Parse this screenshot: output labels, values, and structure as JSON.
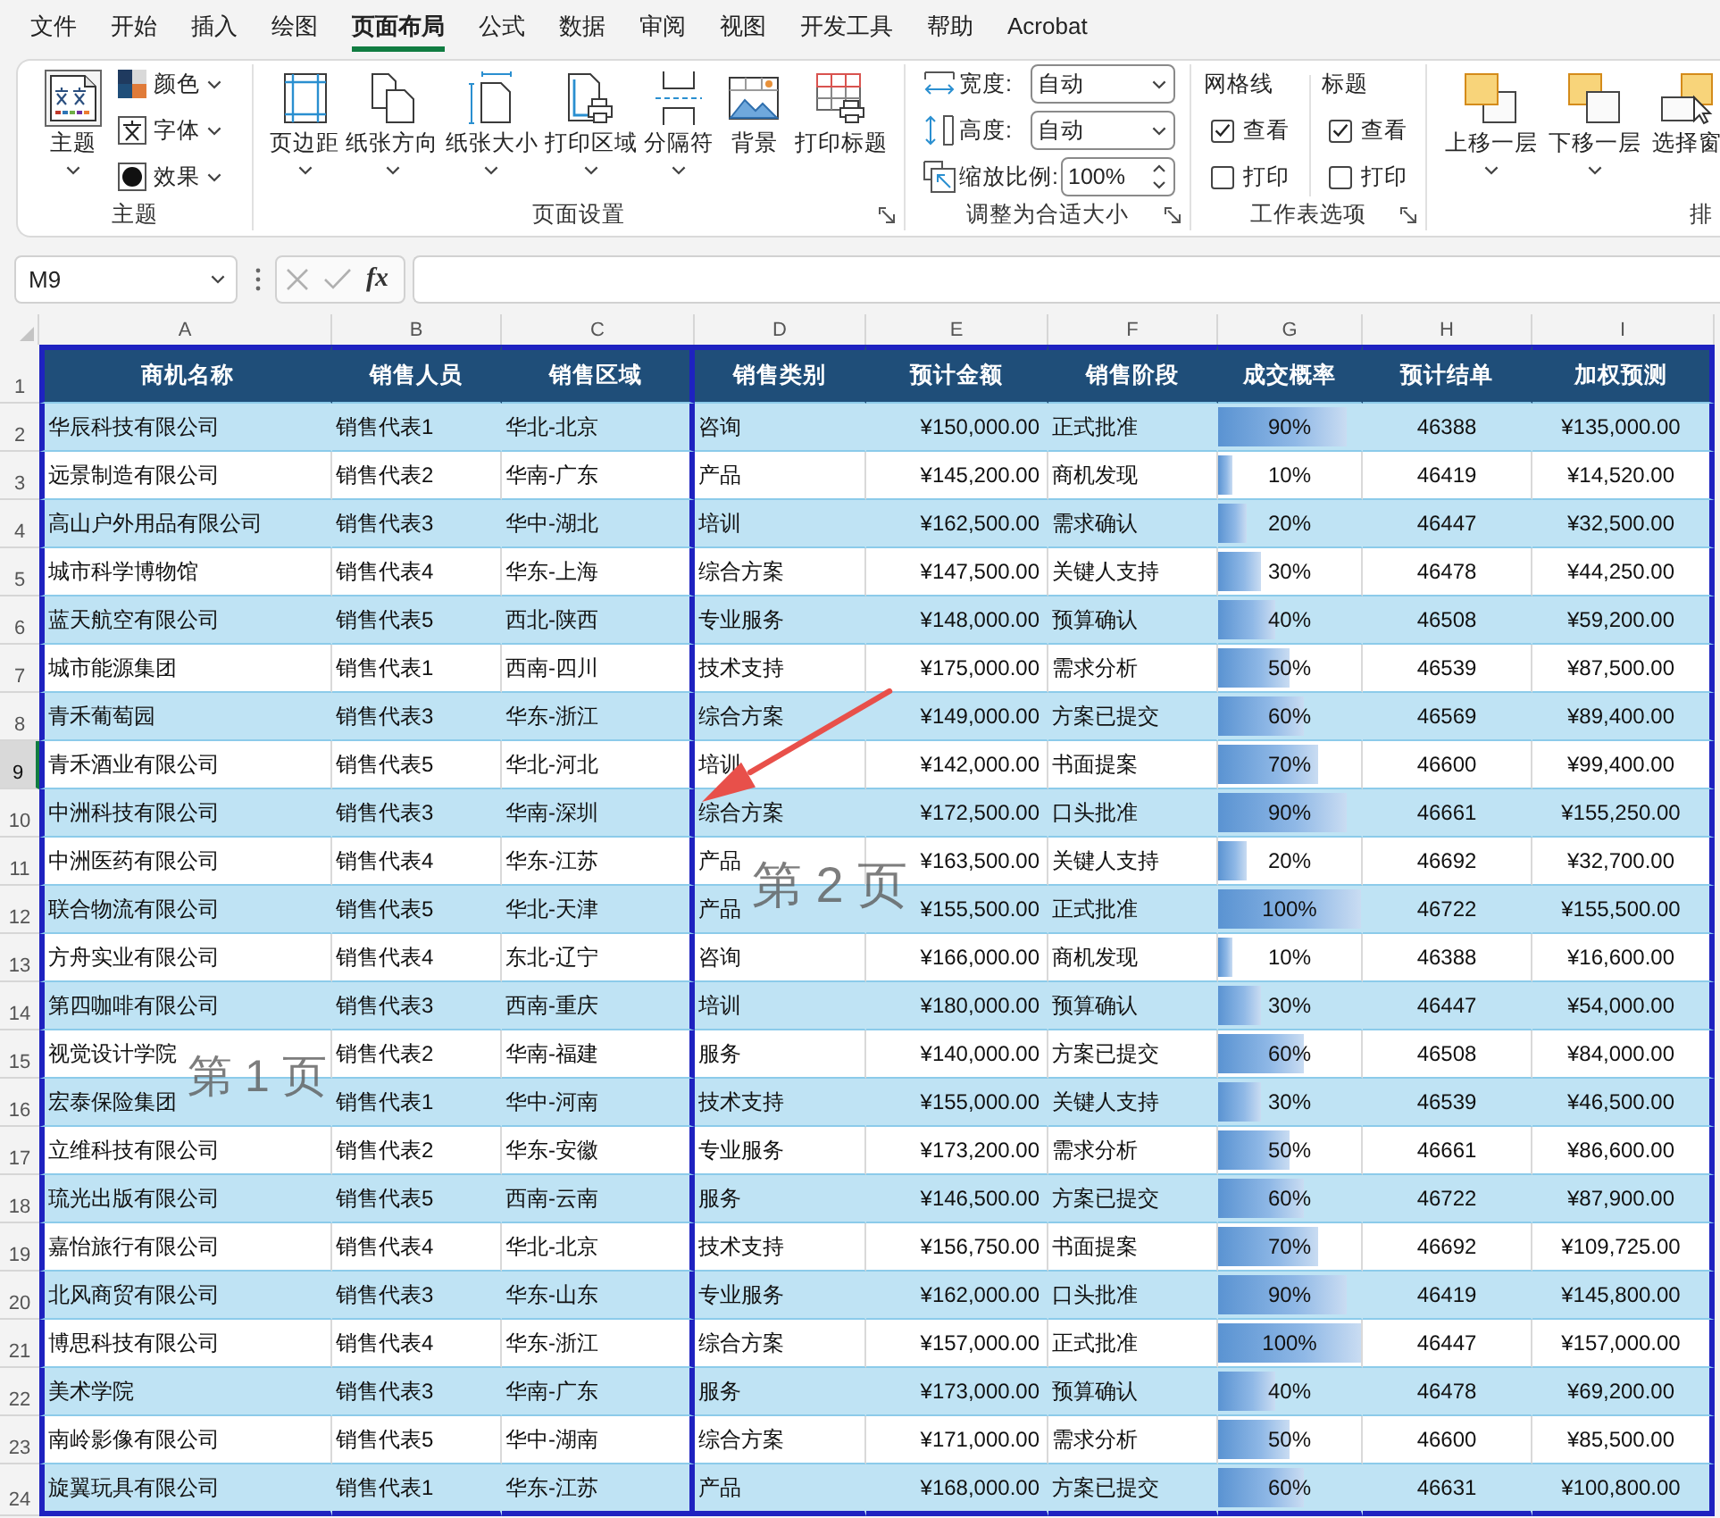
{
  "menu_tabs": [
    {
      "label": "文件",
      "selected": false
    },
    {
      "label": "开始",
      "selected": false
    },
    {
      "label": "插入",
      "selected": false
    },
    {
      "label": "绘图",
      "selected": false
    },
    {
      "label": "页面布局",
      "selected": true
    },
    {
      "label": "公式",
      "selected": false
    },
    {
      "label": "数据",
      "selected": false
    },
    {
      "label": "审阅",
      "selected": false
    },
    {
      "label": "视图",
      "selected": false
    },
    {
      "label": "开发工具",
      "selected": false
    },
    {
      "label": "帮助",
      "selected": false
    },
    {
      "label": "Acrobat",
      "selected": false
    }
  ],
  "ribbon": {
    "theme_group": {
      "label": "主题",
      "button": {
        "label": "主题",
        "has_menu": true
      },
      "dropdowns": [
        {
          "label": "颜色"
        },
        {
          "label": "字体"
        },
        {
          "label": "效果"
        }
      ]
    },
    "page_setup_group": {
      "label": "页面设置",
      "launcher": true,
      "buttons": [
        {
          "label": "页边距",
          "has_menu": true
        },
        {
          "label": "纸张方向",
          "has_menu": true
        },
        {
          "label": "纸张大小",
          "has_menu": true
        },
        {
          "label": "打印区域",
          "has_menu": true
        },
        {
          "label": "分隔符",
          "has_menu": true
        },
        {
          "label": "背景",
          "has_menu": false
        },
        {
          "label": "打印标题",
          "has_menu": false
        }
      ]
    },
    "scale_group": {
      "label": "调整为合适大小",
      "launcher": true,
      "fields": [
        {
          "kind": "dropdown",
          "label": "宽度:",
          "value": "自动"
        },
        {
          "kind": "dropdown",
          "label": "高度:",
          "value": "自动"
        },
        {
          "kind": "spinner",
          "label": "缩放比例:",
          "value": "100%"
        }
      ]
    },
    "sheet_options_group": {
      "label": "工作表选项",
      "launcher": true,
      "columns": [
        {
          "heading": "网格线",
          "options": [
            {
              "label": "查看",
              "checked": true
            },
            {
              "label": "打印",
              "checked": false
            }
          ]
        },
        {
          "heading": "标题",
          "options": [
            {
              "label": "查看",
              "checked": true
            },
            {
              "label": "打印",
              "checked": false
            }
          ]
        }
      ]
    },
    "arrange_group": {
      "label": "排",
      "buttons": [
        {
          "label": "上移一层",
          "has_menu": true
        },
        {
          "label": "下移一层",
          "has_menu": true
        },
        {
          "label": "选择窗",
          "has_menu": false
        }
      ]
    }
  },
  "formula_bar": {
    "name_box": "M9",
    "function_button": "fx"
  },
  "sheet": {
    "column_letters": [
      "A",
      "B",
      "C",
      "D",
      "E",
      "F",
      "G",
      "H",
      "I"
    ],
    "header_row": {
      "row_number": "1",
      "selected": false,
      "titles": [
        "商机名称",
        "销售人员",
        "销售区域",
        "销售类别",
        "预计金额",
        "销售阶段",
        "成交概率",
        "预计结单",
        "加权预测"
      ]
    },
    "rows": [
      {
        "row_number": "2",
        "selected": false,
        "company": "华辰科技有限公司",
        "rep": "销售代表1",
        "region": "华北-北京",
        "category": "咨询",
        "amount": "¥150,000.00",
        "stage": "正式批准",
        "probability": "90%",
        "level": 0.9,
        "expected_close": "46388",
        "weighted": "¥135,000.00"
      },
      {
        "row_number": "3",
        "selected": false,
        "company": "远景制造有限公司",
        "rep": "销售代表2",
        "region": "华南-广东",
        "category": "产品",
        "amount": "¥145,200.00",
        "stage": "商机发现",
        "probability": "10%",
        "level": 0.1,
        "expected_close": "46419",
        "weighted": "¥14,520.00"
      },
      {
        "row_number": "4",
        "selected": false,
        "company": "高山户外用品有限公司",
        "rep": "销售代表3",
        "region": "华中-湖北",
        "category": "培训",
        "amount": "¥162,500.00",
        "stage": "需求确认",
        "probability": "20%",
        "level": 0.2,
        "expected_close": "46447",
        "weighted": "¥32,500.00"
      },
      {
        "row_number": "5",
        "selected": false,
        "company": "城市科学博物馆",
        "rep": "销售代表4",
        "region": "华东-上海",
        "category": "综合方案",
        "amount": "¥147,500.00",
        "stage": "关键人支持",
        "probability": "30%",
        "level": 0.3,
        "expected_close": "46478",
        "weighted": "¥44,250.00"
      },
      {
        "row_number": "6",
        "selected": false,
        "company": "蓝天航空有限公司",
        "rep": "销售代表5",
        "region": "西北-陕西",
        "category": "专业服务",
        "amount": "¥148,000.00",
        "stage": "预算确认",
        "probability": "40%",
        "level": 0.4,
        "expected_close": "46508",
        "weighted": "¥59,200.00"
      },
      {
        "row_number": "7",
        "selected": false,
        "company": "城市能源集团",
        "rep": "销售代表1",
        "region": "西南-四川",
        "category": "技术支持",
        "amount": "¥175,000.00",
        "stage": "需求分析",
        "probability": "50%",
        "level": 0.5,
        "expected_close": "46539",
        "weighted": "¥87,500.00"
      },
      {
        "row_number": "8",
        "selected": false,
        "company": "青禾葡萄园",
        "rep": "销售代表3",
        "region": "华东-浙江",
        "category": "综合方案",
        "amount": "¥149,000.00",
        "stage": "方案已提交",
        "probability": "60%",
        "level": 0.6,
        "expected_close": "46569",
        "weighted": "¥89,400.00"
      },
      {
        "row_number": "9",
        "selected": true,
        "company": "青禾酒业有限公司",
        "rep": "销售代表5",
        "region": "华北-河北",
        "category": "培训",
        "amount": "¥142,000.00",
        "stage": "书面提案",
        "probability": "70%",
        "level": 0.7,
        "expected_close": "46600",
        "weighted": "¥99,400.00"
      },
      {
        "row_number": "10",
        "selected": false,
        "company": "中洲科技有限公司",
        "rep": "销售代表3",
        "region": "华南-深圳",
        "category": "综合方案",
        "amount": "¥172,500.00",
        "stage": "口头批准",
        "probability": "90%",
        "level": 0.9,
        "expected_close": "46661",
        "weighted": "¥155,250.00"
      },
      {
        "row_number": "11",
        "selected": false,
        "company": "中洲医药有限公司",
        "rep": "销售代表4",
        "region": "华东-江苏",
        "category": "产品",
        "amount": "¥163,500.00",
        "stage": "关键人支持",
        "probability": "20%",
        "level": 0.2,
        "expected_close": "46692",
        "weighted": "¥32,700.00"
      },
      {
        "row_number": "12",
        "selected": false,
        "company": "联合物流有限公司",
        "rep": "销售代表5",
        "region": "华北-天津",
        "category": "产品",
        "amount": "¥155,500.00",
        "stage": "正式批准",
        "probability": "100%",
        "level": 1.0,
        "expected_close": "46722",
        "weighted": "¥155,500.00"
      },
      {
        "row_number": "13",
        "selected": false,
        "company": "方舟实业有限公司",
        "rep": "销售代表4",
        "region": "东北-辽宁",
        "category": "咨询",
        "amount": "¥166,000.00",
        "stage": "商机发现",
        "probability": "10%",
        "level": 0.1,
        "expected_close": "46388",
        "weighted": "¥16,600.00"
      },
      {
        "row_number": "14",
        "selected": false,
        "company": "第四咖啡有限公司",
        "rep": "销售代表3",
        "region": "西南-重庆",
        "category": "培训",
        "amount": "¥180,000.00",
        "stage": "预算确认",
        "probability": "30%",
        "level": 0.3,
        "expected_close": "46447",
        "weighted": "¥54,000.00"
      },
      {
        "row_number": "15",
        "selected": false,
        "company": "视觉设计学院",
        "rep": "销售代表2",
        "region": "华南-福建",
        "category": "服务",
        "amount": "¥140,000.00",
        "stage": "方案已提交",
        "probability": "60%",
        "level": 0.6,
        "expected_close": "46508",
        "weighted": "¥84,000.00"
      },
      {
        "row_number": "16",
        "selected": false,
        "company": "宏泰保险集团",
        "rep": "销售代表1",
        "region": "华中-河南",
        "category": "技术支持",
        "amount": "¥155,000.00",
        "stage": "关键人支持",
        "probability": "30%",
        "level": 0.3,
        "expected_close": "46539",
        "weighted": "¥46,500.00"
      },
      {
        "row_number": "17",
        "selected": false,
        "company": "立维科技有限公司",
        "rep": "销售代表2",
        "region": "华东-安徽",
        "category": "专业服务",
        "amount": "¥173,200.00",
        "stage": "需求分析",
        "probability": "50%",
        "level": 0.5,
        "expected_close": "46661",
        "weighted": "¥86,600.00"
      },
      {
        "row_number": "18",
        "selected": false,
        "company": "琉光出版有限公司",
        "rep": "销售代表5",
        "region": "西南-云南",
        "category": "服务",
        "amount": "¥146,500.00",
        "stage": "方案已提交",
        "probability": "60%",
        "level": 0.6,
        "expected_close": "46722",
        "weighted": "¥87,900.00"
      },
      {
        "row_number": "19",
        "selected": false,
        "company": "嘉怡旅行有限公司",
        "rep": "销售代表4",
        "region": "华北-北京",
        "category": "技术支持",
        "amount": "¥156,750.00",
        "stage": "书面提案",
        "probability": "70%",
        "level": 0.7,
        "expected_close": "46692",
        "weighted": "¥109,725.00"
      },
      {
        "row_number": "20",
        "selected": false,
        "company": "北风商贸有限公司",
        "rep": "销售代表3",
        "region": "华东-山东",
        "category": "专业服务",
        "amount": "¥162,000.00",
        "stage": "口头批准",
        "probability": "90%",
        "level": 0.9,
        "expected_close": "46419",
        "weighted": "¥145,800.00"
      },
      {
        "row_number": "21",
        "selected": false,
        "company": "博思科技有限公司",
        "rep": "销售代表4",
        "region": "华东-浙江",
        "category": "综合方案",
        "amount": "¥157,000.00",
        "stage": "正式批准",
        "probability": "100%",
        "level": 1.0,
        "expected_close": "46447",
        "weighted": "¥157,000.00"
      },
      {
        "row_number": "22",
        "selected": false,
        "company": "美术学院",
        "rep": "销售代表3",
        "region": "华南-广东",
        "category": "服务",
        "amount": "¥173,000.00",
        "stage": "预算确认",
        "probability": "40%",
        "level": 0.4,
        "expected_close": "46478",
        "weighted": "¥69,200.00"
      },
      {
        "row_number": "23",
        "selected": false,
        "company": "南岭影像有限公司",
        "rep": "销售代表5",
        "region": "华中-湖南",
        "category": "综合方案",
        "amount": "¥171,000.00",
        "stage": "需求分析",
        "probability": "50%",
        "level": 0.5,
        "expected_close": "46600",
        "weighted": "¥85,500.00"
      },
      {
        "row_number": "24",
        "selected": false,
        "company": "旋翼玩具有限公司",
        "rep": "销售代表1",
        "region": "华东-江苏",
        "category": "产品",
        "amount": "¥168,000.00",
        "stage": "方案已提交",
        "probability": "60%",
        "level": 0.6,
        "expected_close": "46631",
        "weighted": "¥100,800.00"
      }
    ],
    "page_labels": [
      "第 1 页",
      "第 2 页"
    ]
  }
}
